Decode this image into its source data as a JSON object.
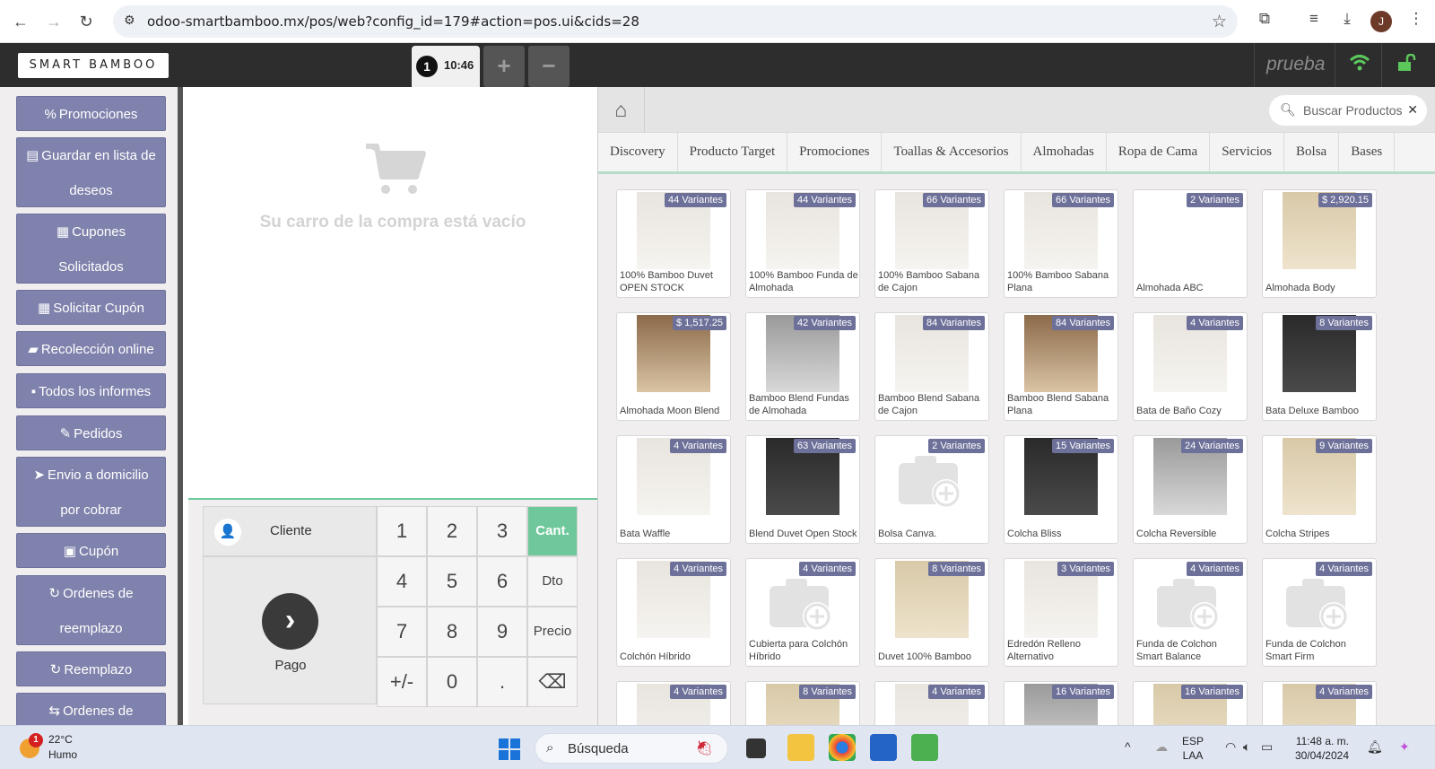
{
  "browser": {
    "url": "odoo-smartbamboo.mx/pos/web?config_id=179#action=pos.ui&cids=28",
    "avatar_letter": "J"
  },
  "pos_header": {
    "logo_text": "SMART BAMBOO",
    "order_number": "1",
    "order_time": "10:46",
    "add_order_label": "+",
    "remove_order_label": "−",
    "user_name": "prueba"
  },
  "control_buttons": [
    {
      "icon": "%",
      "label": "Promociones"
    },
    {
      "icon": "▤",
      "label": "Guardar en lista de deseos"
    },
    {
      "icon": "▦",
      "label": "Cupones Solicitados"
    },
    {
      "icon": "▦",
      "label": "Solicitar Cupón"
    },
    {
      "icon": "▰",
      "label": "Recolección online"
    },
    {
      "icon": "▪",
      "label": "Todos los informes"
    },
    {
      "icon": "✎",
      "label": "Pedidos"
    },
    {
      "icon": "➤",
      "label": "Envio a domicilio por cobrar"
    },
    {
      "icon": "▣",
      "label": "Cupón"
    },
    {
      "icon": "↻",
      "label": "Ordenes de reemplazo"
    },
    {
      "icon": "↻",
      "label": "Reemplazo"
    },
    {
      "icon": "⇆",
      "label": "Ordenes de"
    }
  ],
  "order": {
    "empty_message": "Su carro de la compra está vacío"
  },
  "actionpad": {
    "customer_label": "Cliente",
    "pay_label": "Pago"
  },
  "numpad": {
    "keys": [
      "1",
      "2",
      "3",
      "4",
      "5",
      "6",
      "7",
      "8",
      "9",
      "+/-",
      "0",
      "."
    ],
    "mode_qty": "Cant.",
    "mode_disc": "Dto",
    "mode_price": "Precio",
    "backspace": "⌫"
  },
  "search": {
    "placeholder": "Buscar Productos"
  },
  "categories": [
    "Discovery",
    "Producto Target",
    "Promociones",
    "Toallas & Accesorios",
    "Almohadas",
    "Ropa de Cama",
    "Servicios",
    "Bolsa",
    "Bases"
  ],
  "products": [
    {
      "name": "100% Bamboo Duvet OPEN STOCK",
      "badge": "44 Variantes",
      "img": "light"
    },
    {
      "name": "100% Bamboo Funda de Almohada",
      "badge": "44 Variantes",
      "img": "light"
    },
    {
      "name": "100% Bamboo Sabana de Cajon",
      "badge": "66 Variantes",
      "img": "light"
    },
    {
      "name": "100% Bamboo Sabana Plana",
      "badge": "66 Variantes",
      "img": "light"
    },
    {
      "name": "Almohada ABC",
      "badge": "2 Variantes",
      "img": "plain"
    },
    {
      "name": "Almohada Body",
      "badge": "$ 2,920.15",
      "img": "beige"
    },
    {
      "name": "Almohada Moon Blend",
      "badge": "$ 1,517.25",
      "img": "wood"
    },
    {
      "name": "Bamboo Blend Fundas de Almohada",
      "badge": "42 Variantes",
      "img": "gray"
    },
    {
      "name": "Bamboo Blend Sabana de Cajon",
      "badge": "84 Variantes",
      "img": "light"
    },
    {
      "name": "Bamboo Blend Sabana Plana",
      "badge": "84 Variantes",
      "img": "wood"
    },
    {
      "name": "Bata de Baño Cozy",
      "badge": "4 Variantes",
      "img": "light"
    },
    {
      "name": "Bata Deluxe Bamboo",
      "badge": "8 Variantes",
      "img": "dark"
    },
    {
      "name": "Bata Waffle",
      "badge": "4 Variantes",
      "img": "light"
    },
    {
      "name": "Blend Duvet Open Stock",
      "badge": "63 Variantes",
      "img": "dark"
    },
    {
      "name": "Bolsa Canva.",
      "badge": "2 Variantes",
      "img": "placeholder"
    },
    {
      "name": "Colcha Bliss",
      "badge": "15 Variantes",
      "img": "dark"
    },
    {
      "name": "Colcha Reversible",
      "badge": "24 Variantes",
      "img": "gray"
    },
    {
      "name": "Colcha Stripes",
      "badge": "9 Variantes",
      "img": "beige"
    },
    {
      "name": "Colchón Híbrido",
      "badge": "4 Variantes",
      "img": "light"
    },
    {
      "name": "Cubierta para Colchón Híbrido",
      "badge": "4 Variantes",
      "img": "placeholder"
    },
    {
      "name": "Duvet 100% Bamboo",
      "badge": "8 Variantes",
      "img": "beige"
    },
    {
      "name": "Edredón Relleno Alternativo",
      "badge": "3 Variantes",
      "img": "light"
    },
    {
      "name": "Funda de Colchon Smart Balance",
      "badge": "4 Variantes",
      "img": "placeholder"
    },
    {
      "name": "Funda de Colchon Smart Firm",
      "badge": "4 Variantes",
      "img": "placeholder"
    },
    {
      "name": "",
      "badge": "4 Variantes",
      "img": "light"
    },
    {
      "name": "",
      "badge": "8 Variantes",
      "img": "beige"
    },
    {
      "name": "",
      "badge": "4 Variantes",
      "img": "light"
    },
    {
      "name": "",
      "badge": "16 Variantes",
      "img": "gray"
    },
    {
      "name": "",
      "badge": "16 Variantes",
      "img": "beige"
    },
    {
      "name": "",
      "badge": "4 Variantes",
      "img": "beige"
    }
  ],
  "taskbar": {
    "weather_alert": "1",
    "temperature": "22°C",
    "condition": "Humo",
    "search_placeholder": "Búsqueda",
    "lang_line1": "ESP",
    "lang_line2": "LAA",
    "time": "11:48 a. m.",
    "date": "30/04/2024"
  },
  "colors": {
    "control_button": "#7f82ac",
    "active_mode": "#6ec89b",
    "badge": "#6d7199",
    "header": "#2d2d2d"
  }
}
